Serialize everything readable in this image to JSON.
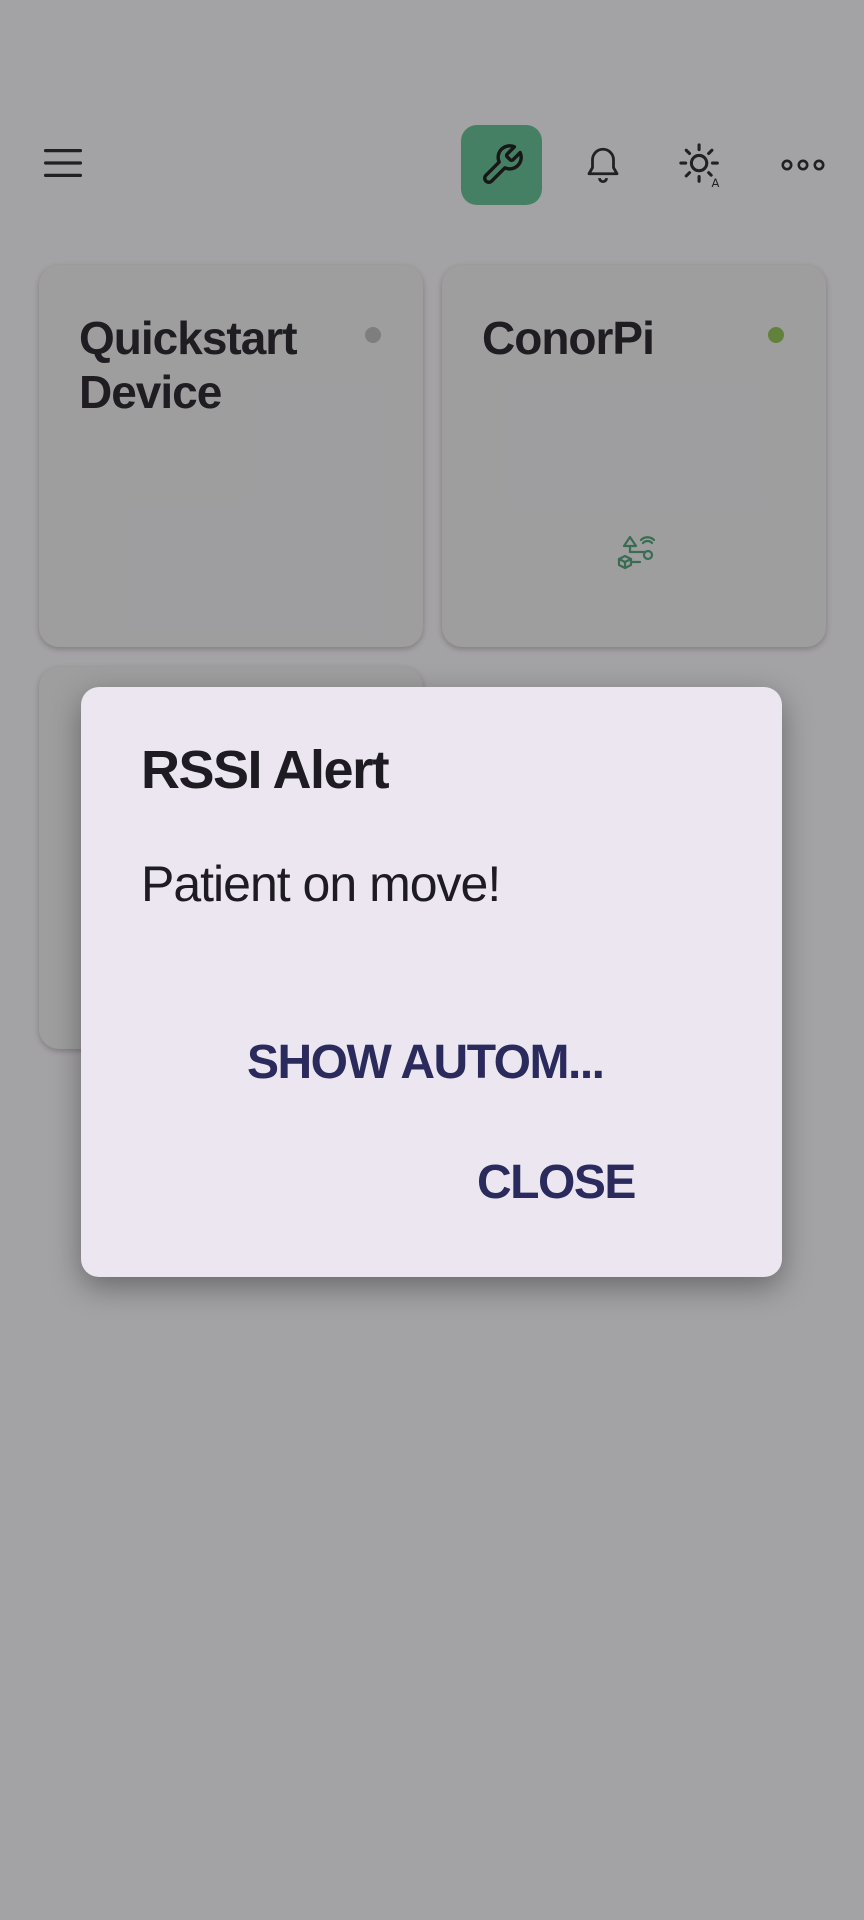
{
  "topbar": {
    "menu_icon": "menu-icon",
    "tool_icon": "wrench-icon",
    "bell_icon": "bell-icon",
    "theme_icon": "brightness-auto-icon",
    "more_icon": "more-horiz-icon",
    "accent_color": "#5fc08f"
  },
  "devices": [
    {
      "name": "Quickstart Device",
      "status": "offline",
      "status_color": "#bdbdbd"
    },
    {
      "name": "ConorPi",
      "status": "online",
      "status_color": "#8bc34a",
      "icon": "automation-flow-icon"
    },
    {
      "name": "",
      "status": ""
    }
  ],
  "dialog": {
    "title": "RSSI Alert",
    "message": "Patient on move!",
    "show_automations_label": "SHOW AUTOM...",
    "close_label": "CLOSE"
  }
}
